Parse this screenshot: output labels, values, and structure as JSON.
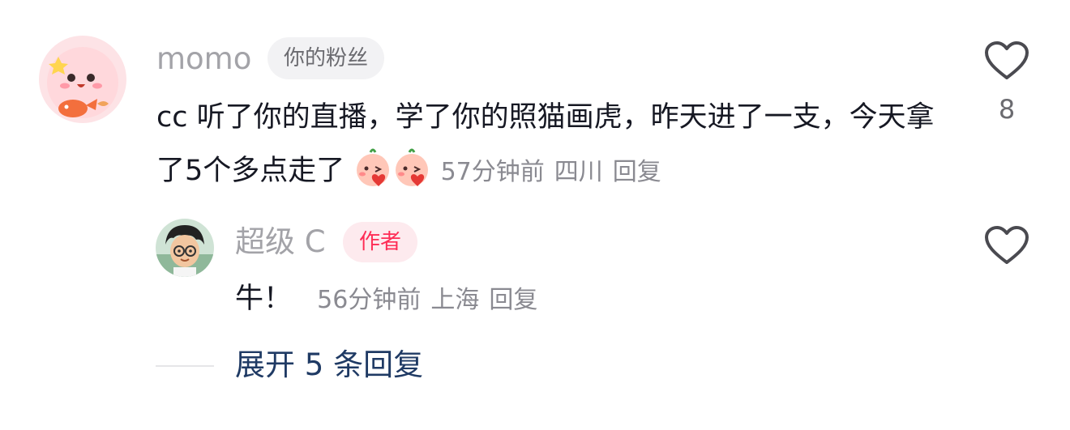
{
  "comment": {
    "username": "momo",
    "badge": "你的粉丝",
    "text": "cc 听了你的直播，学了你的照猫画虎，昨天进了一支，今天拿了5个多点走了",
    "emoji": "kissing-face-emoji",
    "time": "57分钟前",
    "location": "四川",
    "reply_label": "回复",
    "like_count": "8"
  },
  "reply": {
    "username": "超级 C",
    "badge": "作者",
    "text": "牛！",
    "time": "56分钟前",
    "location": "上海",
    "reply_label": "回复"
  },
  "expand_label": "展开 5 条回复",
  "colors": {
    "author_badge": "#fe2c55",
    "expand_link": "#1f3a64",
    "meta_text": "#8a8a91"
  }
}
